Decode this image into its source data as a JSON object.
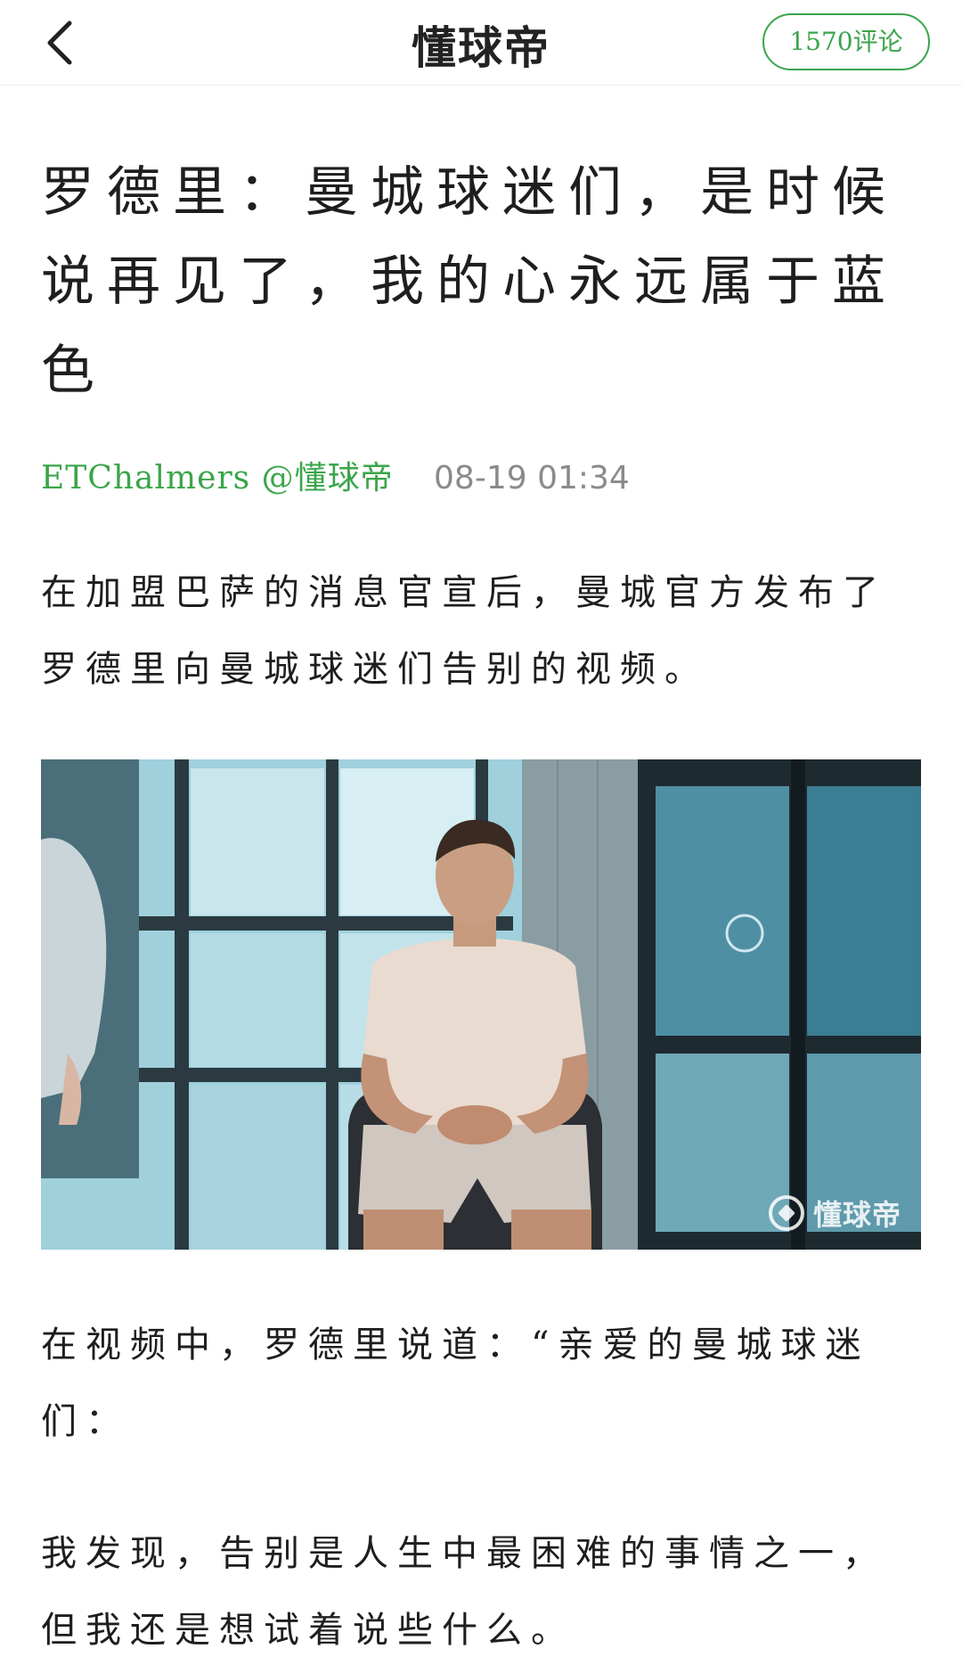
{
  "header": {
    "back_icon": "chevron-left-icon",
    "title": "懂球帝",
    "comments_label": "1570评论",
    "accent_color": "#3aa54a"
  },
  "article": {
    "title": "罗德里：曼城球迷们，是时候说再见了，我的心永远属于蓝色",
    "author": "ETChalmers @懂球帝",
    "timestamp": "08-19 01:34",
    "paragraphs": [
      "在加盟巴萨的消息官宣后，曼城官方发布了罗德里向曼城球迷们告别的视频。",
      "在视频中，罗德里说道：“亲爱的曼城球迷们：",
      "我发现，告别是人生中最困难的事情之一，但我还是想试着说些什么。"
    ]
  },
  "video": {
    "watermark": "懂球帝"
  }
}
